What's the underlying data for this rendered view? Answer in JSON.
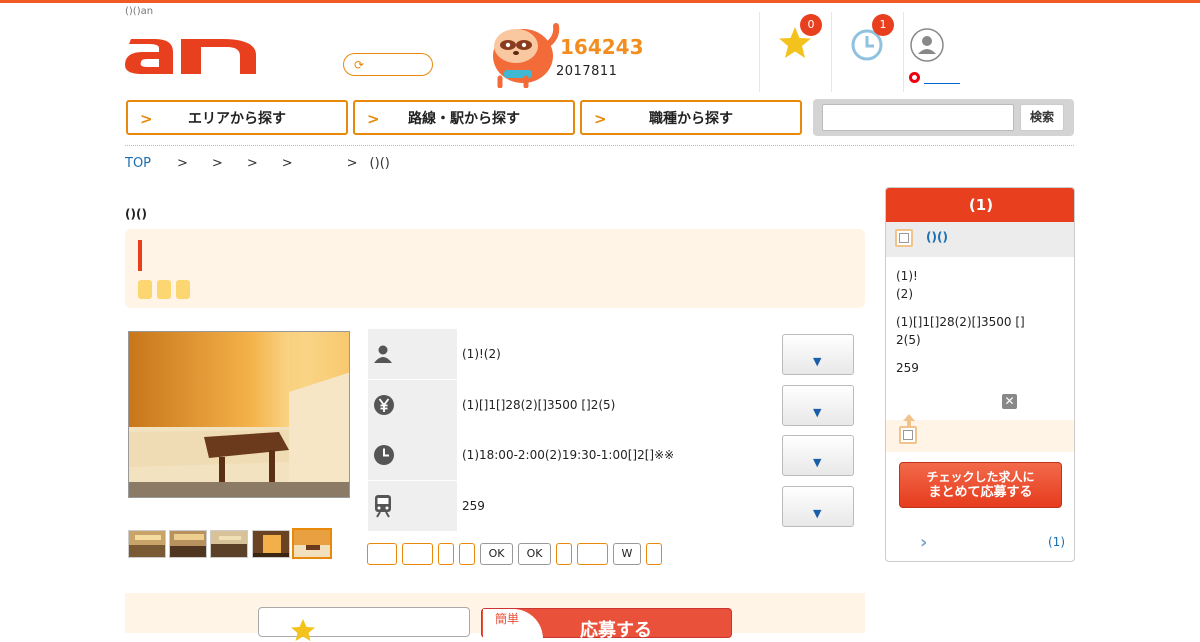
{
  "header": {
    "tagline": "()()an",
    "logo_text": "an",
    "job_count_big": "164243",
    "job_count_small": "2017811",
    "favorites_badge": "0",
    "history_badge": "1",
    "colors": {
      "accent": "#f15a24",
      "orange": "#e8890c",
      "badge": "#e8401f"
    }
  },
  "nav": {
    "area_label": "エリアから探す",
    "route_label": "路線・駅から探す",
    "job_label": "職種から探す",
    "search_button": "検索",
    "search_placeholder": ""
  },
  "breadcrumb": {
    "top": "TOP",
    "sep": ">",
    "last": "()()"
  },
  "job": {
    "title_small": "()()",
    "info_rows": [
      {
        "icon": "person-icon",
        "text": "(1)!(2)"
      },
      {
        "icon": "yen-icon",
        "text": "(1)[]1[]28(2)[]3500 []2(5)"
      },
      {
        "icon": "clock-icon",
        "text": "(1)18:00-2:00(2)19:30-1:00[]2[]※※"
      },
      {
        "icon": "train-icon",
        "text": "259"
      }
    ],
    "expand_arrow": "▼",
    "features": [
      "",
      "",
      "",
      "",
      "OK",
      "OK",
      "",
      "",
      "W",
      ""
    ]
  },
  "apply": {
    "easy_label": "簡単",
    "apply_label": "応募する"
  },
  "sidebar": {
    "header": "(1)",
    "item_link": "()()",
    "lines": [
      "(1)!",
      "(2)",
      "(1)[]1[]28(2)[]3500 []",
      "2(5)",
      "259"
    ],
    "close_glyph": "✕",
    "cta_line1": "チェックした求人に",
    "cta_line2": "まとめて応募する",
    "more_count": "(1)"
  }
}
